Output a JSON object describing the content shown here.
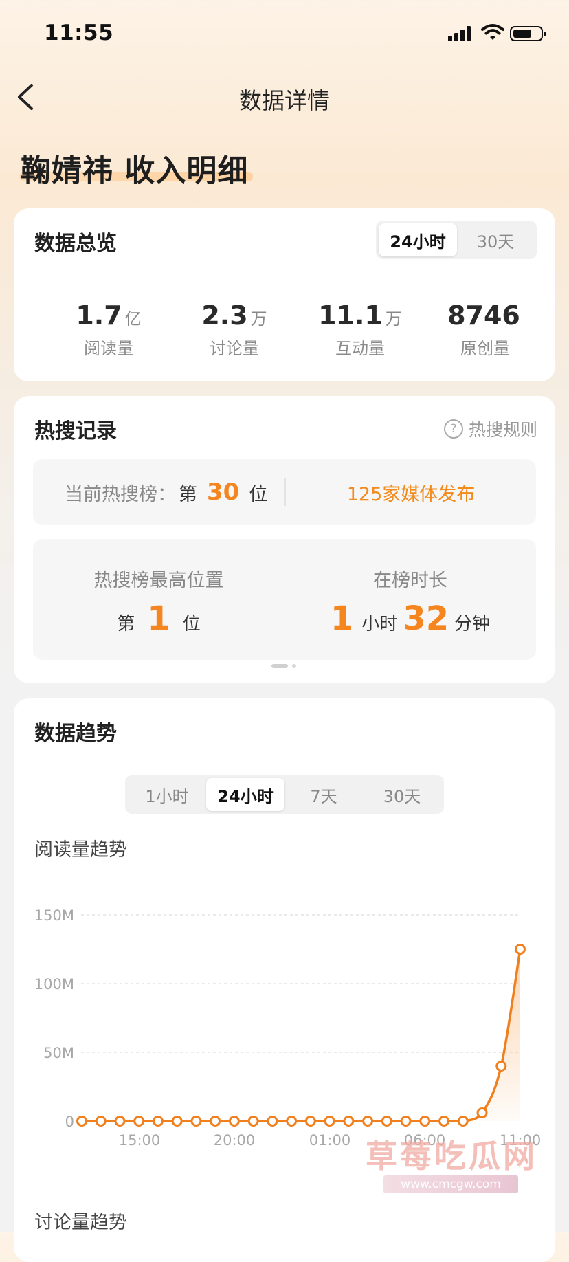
{
  "status_bar": {
    "time": "11:55"
  },
  "nav": {
    "title": "数据详情"
  },
  "page": {
    "title": "鞠婧祎 收入明细"
  },
  "overview": {
    "title": "数据总览",
    "tabs": [
      "24小时",
      "30天"
    ],
    "active_tab": "24小时",
    "stats": [
      {
        "value": "1.7",
        "unit": "亿",
        "label": "阅读量"
      },
      {
        "value": "2.3",
        "unit": "万",
        "label": "讨论量"
      },
      {
        "value": "11.1",
        "unit": "万",
        "label": "互动量"
      },
      {
        "value": "8746",
        "unit": "",
        "label": "原创量"
      }
    ]
  },
  "hot_search": {
    "title": "热搜记录",
    "rules_label": "热搜规则",
    "current_prefix": "当前热搜榜：",
    "current_di": "第",
    "current_rank": "30",
    "current_wei": "位",
    "media_text": "125家媒体发布",
    "highest_label": "热搜榜最高位置",
    "highest_di": "第",
    "highest_rank": "1",
    "highest_wei": "位",
    "duration_label": "在榜时长",
    "duration_hours": "1",
    "duration_hours_unit": "小时",
    "duration_minutes": "32",
    "duration_minutes_unit": "分钟"
  },
  "trend": {
    "title": "数据趋势",
    "tabs": [
      "1小时",
      "24小时",
      "7天",
      "30天"
    ],
    "active_tab": "24小时",
    "read_chart_title": "阅读量趋势",
    "discuss_chart_title": "讨论量趋势"
  },
  "watermark": {
    "text": "草莓吃瓜网",
    "url": "www.cmcgw.com"
  },
  "colors": {
    "accent": "#f5861f",
    "line": "#f07f1e"
  },
  "chart_data": {
    "type": "line",
    "title": "阅读量趋势",
    "y_ticks": [
      "150M",
      "100M",
      "50M",
      "0"
    ],
    "x_ticks": [
      "15:00",
      "20:00",
      "01:00",
      "06:00",
      "11:00"
    ],
    "ylim": [
      0,
      150000000
    ],
    "grid": true,
    "series": [
      {
        "values": [
          0,
          0,
          0,
          0,
          0,
          0,
          0,
          0,
          0,
          0,
          0,
          0,
          0,
          0,
          0,
          0,
          0,
          0,
          0,
          0,
          0,
          6000000,
          40000000,
          125000000
        ]
      }
    ]
  }
}
